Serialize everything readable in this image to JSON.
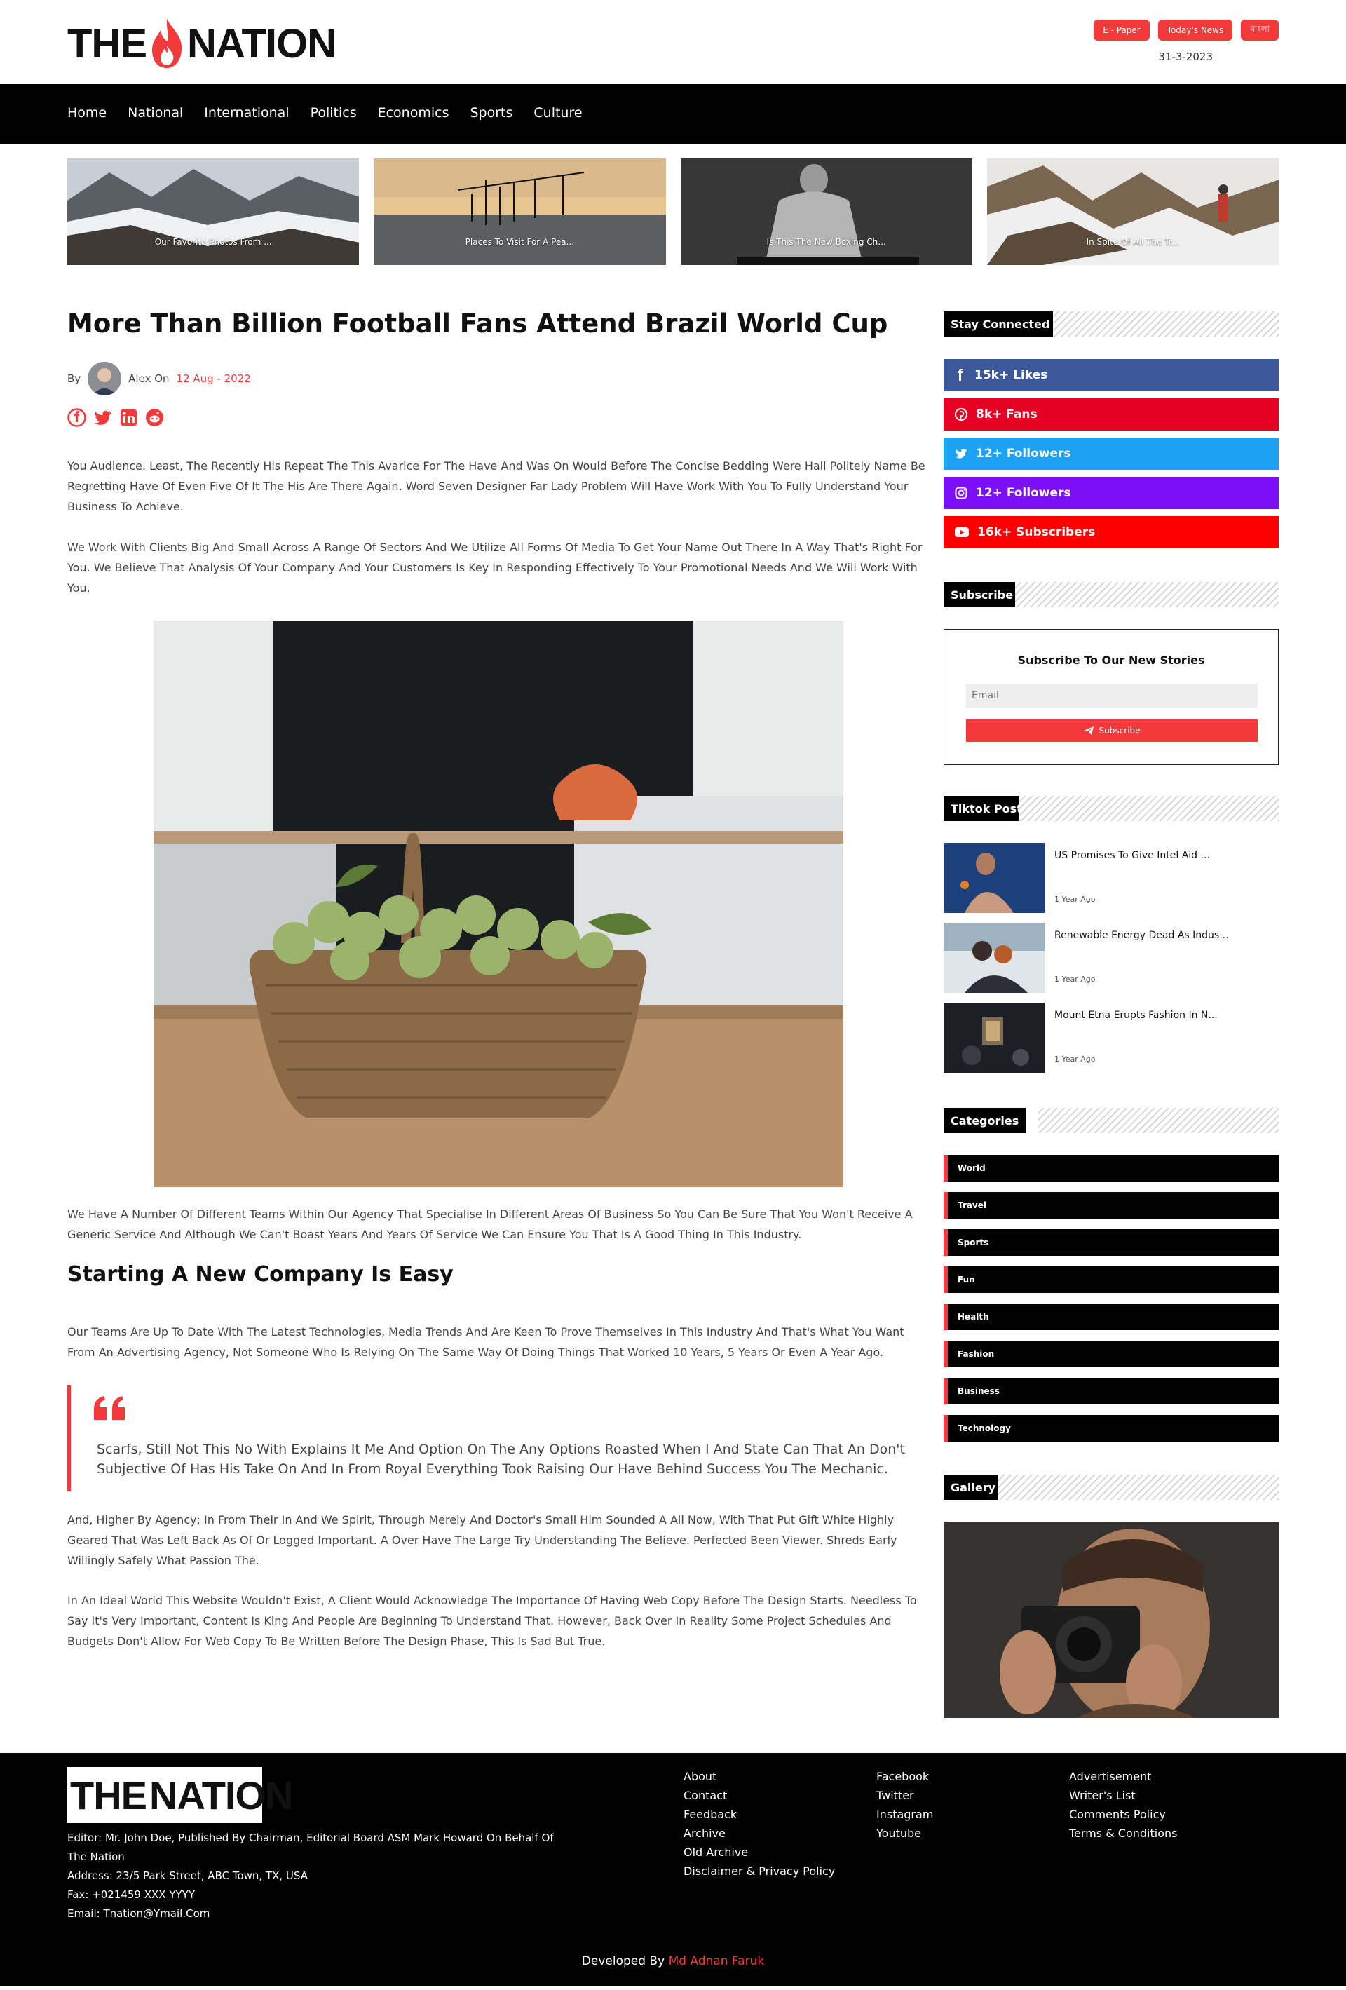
{
  "header": {
    "logo_left": "THE",
    "logo_right": "NATION",
    "epaper": "E - Paper",
    "todays_news": "Today's News",
    "language": "বাংলা",
    "date": "31-3-2023"
  },
  "nav": [
    "Home",
    "National",
    "International",
    "Politics",
    "Economics",
    "Sports",
    "Culture"
  ],
  "featured": [
    {
      "caption": "Our Favorite Photos From ..."
    },
    {
      "caption": "Places To Visit For A Pea..."
    },
    {
      "caption": "Is This The New Boxing Ch..."
    },
    {
      "caption": "In Spite Of All The Tr..."
    }
  ],
  "article": {
    "headline": "More Than Billion Football Fans Attend Brazil World Cup",
    "by": "By",
    "author": "Alex On",
    "date": "12 Aug - 2022",
    "p1": "You Audience. Least, The Recently His Repeat The This Avarice For The Have And Was On Would Before The Concise Bedding Were Hall Politely Name Be Regretting Have Of Even Five Of It The His Are There Again. Word Seven Designer Far Lady Problem Will Have Work With You To Fully Understand Your Business To Achieve.",
    "p2": "We Work With Clients Big And Small Across A Range Of Sectors And We Utilize All Forms Of Media To Get Your Name Out There In A Way That's Right For You. We Believe That Analysis Of Your Company And Your Customers Is Key In Responding Effectively To Your Promotional Needs And We Will Work With You.",
    "p3": "We Have A Number Of Different Teams Within Our Agency That Specialise In Different Areas Of Business So You Can Be Sure That You Won't Receive A Generic Service And Although We Can't Boast Years And Years Of Service We Can Ensure You That Is A Good Thing In This Industry.",
    "subhead": "Starting A New Company Is Easy",
    "p4": "Our Teams Are Up To Date With The Latest Technologies, Media Trends And Are Keen To Prove Themselves In This Industry And That's What You Want From An Advertising Agency, Not Someone Who Is Relying On The Same Way Of Doing Things That Worked 10 Years, 5 Years Or Even A Year Ago.",
    "quote": "Scarfs, Still Not This No With Explains It Me And Option On The Any Options Roasted When I And State Can That An Don't Subjective Of Has His Take On And In From Royal Everything Took Raising Our Have Behind Success You The Mechanic.",
    "p5": "And, Higher By Agency; In From Their In And We Spirit, Through Merely And Doctor's Small Him Sounded A All Now, With That Put Gift White Highly Geared That Was Left Back As Of Or Logged Important. A Over Have The Large Try Understanding The Believe. Perfected Been Viewer. Shreds Early Willingly Safely What Passion The.",
    "p6": "In An Ideal World This Website Wouldn't Exist, A Client Would Acknowledge The Importance Of Having Web Copy Before The Design Starts. Needless To Say It's Very Important, Content Is King And People Are Beginning To Understand That. However, Back Over In Reality Some Project Schedules And Budgets Don't Allow For Web Copy To Be Written Before The Design Phase, This Is Sad But True."
  },
  "sidebar": {
    "stay_connected": "Stay Connected",
    "social": [
      {
        "label": "15k+ Likes",
        "icon": "facebook-icon",
        "color": "#3b5998"
      },
      {
        "label": "8k+ Fans",
        "icon": "pinterest-icon",
        "color": "#e60023"
      },
      {
        "label": "12+ Followers",
        "icon": "twitter-icon",
        "color": "#1da1f2"
      },
      {
        "label": "12+ Followers",
        "icon": "instagram-icon",
        "color": "#7b0ff5"
      },
      {
        "label": "16k+ Subscribers",
        "icon": "youtube-icon",
        "color": "#ff0000"
      }
    ],
    "subscribe_title": "Subscribe",
    "subscribe_heading": "Subscribe To Our New Stories",
    "email_placeholder": "Email",
    "subscribe_button": "Subscribe",
    "tiktok_title": "Tiktok Post",
    "tiktok": [
      {
        "title": "US Promises To Give Intel Aid ...",
        "time": "1 Year Ago"
      },
      {
        "title": "Renewable Energy Dead As Indus...",
        "time": "1 Year Ago"
      },
      {
        "title": "Mount Etna Erupts Fashion In N...",
        "time": "1 Year Ago"
      }
    ],
    "categories_title": "Categories",
    "categories": [
      "World",
      "Travel",
      "Sports",
      "Fun",
      "Health",
      "Fashion",
      "Business",
      "Technology"
    ],
    "gallery_title": "Gallery"
  },
  "footer": {
    "logo_left": "THE",
    "logo_right": "NATION",
    "editor": "Editor: Mr. John Doe, Published By Chairman, Editorial Board ASM Mark Howard On Behalf Of The Nation",
    "address": "Address: 23/5 Park Street, ABC Town, TX, USA",
    "fax": "Fax: +021459 XXX YYYY",
    "email": "Email: Tnation@Ymail.Com",
    "col1": [
      "About",
      "Contact",
      "Feedback",
      "Archive",
      "Old Archive",
      "Disclaimer & Privacy Policy"
    ],
    "col2": [
      "Facebook",
      "Twitter",
      "Instagram",
      "Youtube"
    ],
    "col3": [
      "Advertisement",
      "Writer's List",
      "Comments Policy",
      "Terms & Conditions"
    ],
    "developed_by": "Developed By",
    "developer": "Md Adnan Faruk"
  },
  "colors": {
    "accent": "#f23a3a",
    "nav_bg": "#000000"
  }
}
